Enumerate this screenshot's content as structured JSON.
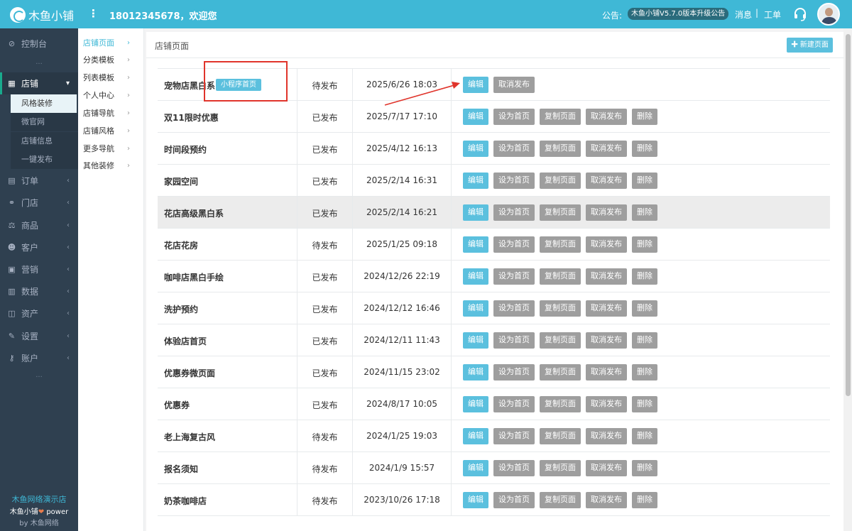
{
  "topbar": {
    "logo_text": "木鱼小铺",
    "menu_icon": "vertical-dots-icon",
    "welcome": "18012345678，欢迎您",
    "notice_label": "公告:",
    "notice_text": "木鱼小铺V5.7.0版本升级公告",
    "messages": "消息",
    "separator": "|",
    "work_order": "工单",
    "support_icon": "headset-icon"
  },
  "sidebar": {
    "items": [
      {
        "label": "控制台",
        "icon": "dashboard-icon",
        "glyph": "⊘"
      },
      {
        "label": "店铺",
        "icon": "store-icon",
        "glyph": "▦"
      },
      {
        "label": "订单",
        "icon": "order-icon",
        "glyph": "▤"
      },
      {
        "label": "门店",
        "icon": "branch-icon",
        "glyph": "⚭"
      },
      {
        "label": "商品",
        "icon": "scale-icon",
        "glyph": "⚖"
      },
      {
        "label": "客户",
        "icon": "users-icon",
        "glyph": "☻"
      },
      {
        "label": "营销",
        "icon": "marketing-icon",
        "glyph": "▣"
      },
      {
        "label": "数据",
        "icon": "bar-chart-icon",
        "glyph": "▥"
      },
      {
        "label": "资产",
        "icon": "wallet-icon",
        "glyph": "◫"
      },
      {
        "label": "设置",
        "icon": "wrench-icon",
        "glyph": "✎"
      },
      {
        "label": "账户",
        "icon": "key-icon",
        "glyph": "⚷"
      }
    ],
    "sub_items": [
      "风格装修",
      "微官网",
      "店铺信息",
      "一键发布"
    ],
    "dots": "...",
    "footer": {
      "shop_name": "木鱼网络演示店",
      "power_prefix": "木鱼小铺",
      "power_suffix": " power",
      "by": "by 木鱼网络"
    }
  },
  "submenu": {
    "items": [
      "店铺页面",
      "分类模板",
      "列表模板",
      "个人中心",
      "店铺导航",
      "店铺风格",
      "更多导航",
      "其他装修"
    ]
  },
  "panel": {
    "title": "店铺页面",
    "new_button": "✚ 新建页面"
  },
  "buttons": {
    "edit": "编辑",
    "set_home": "设为首页",
    "copy": "复制页面",
    "unpublish": "取消发布",
    "delete": "删除"
  },
  "rows": [
    {
      "name": "宠物店黑白系",
      "tag": "小程序首页",
      "status": "待发布",
      "time": "2025/6/26 18:03"
    },
    {
      "name": "双11限时优惠",
      "status": "已发布",
      "time": "2025/7/17 17:10"
    },
    {
      "name": "时间段预约",
      "status": "已发布",
      "time": "2025/4/12 16:13"
    },
    {
      "name": "家园空间",
      "status": "已发布",
      "time": "2025/2/14 16:31"
    },
    {
      "name": "花店高级黑白系",
      "status": "已发布",
      "time": "2025/2/14 16:21"
    },
    {
      "name": "花店花房",
      "status": "待发布",
      "time": "2025/1/25 09:18"
    },
    {
      "name": "咖啡店黑白手绘",
      "status": "已发布",
      "time": "2024/12/26 22:19"
    },
    {
      "name": "洗护预约",
      "status": "已发布",
      "time": "2024/12/12 16:46"
    },
    {
      "name": "体验店首页",
      "status": "已发布",
      "time": "2024/12/11 11:43"
    },
    {
      "name": "优惠券微页面",
      "status": "已发布",
      "time": "2024/11/15 23:02"
    },
    {
      "name": "优惠券",
      "status": "已发布",
      "time": "2024/8/17 10:05"
    },
    {
      "name": "老上海复古风",
      "status": "待发布",
      "time": "2024/1/25 19:03"
    },
    {
      "name": "报名须知",
      "status": "待发布",
      "time": "2024/1/9 15:57"
    },
    {
      "name": "奶茶咖啡店",
      "status": "待发布",
      "time": "2023/10/26 17:18"
    }
  ],
  "colors": {
    "accent": "#3fb8d6",
    "sidebar_bg": "#2f4050",
    "edit_button": "#5bc0de",
    "gray_button": "#9e9e9e",
    "annotation_red": "#e0342b"
  }
}
